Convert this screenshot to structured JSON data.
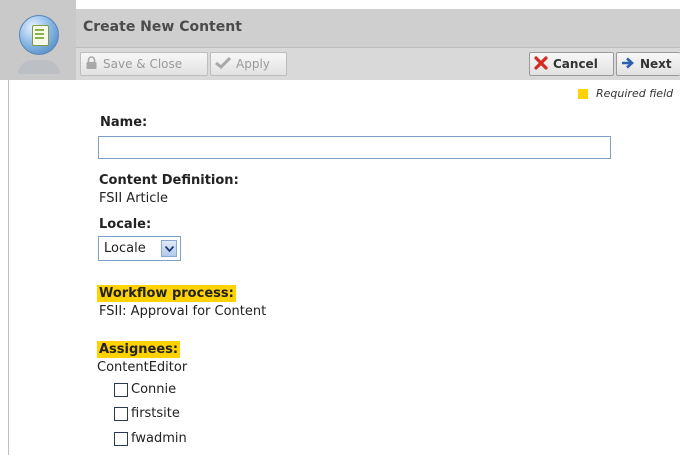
{
  "header": {
    "title": "Create New Content"
  },
  "toolbar": {
    "save_close": {
      "label": "Save & Close",
      "icon": "lock-icon"
    },
    "apply": {
      "label": "Apply",
      "icon": "checkmark-icon"
    },
    "cancel": {
      "label": "Cancel",
      "icon": "x-icon"
    },
    "next": {
      "label": "Next",
      "icon": "arrow-right-icon"
    }
  },
  "form": {
    "required_note": "Required field",
    "name_label": "Name:",
    "name_value": "",
    "content_definition_label": "Content Definition:",
    "content_definition_value": "FSII Article",
    "locale_label": "Locale:",
    "locale_selected": "Locale",
    "workflow_label": "Workflow process:",
    "workflow_value": "FSII: Approval for Content",
    "assignees_label": "Assignees:",
    "assignees_role": "ContentEditor",
    "assignees": [
      {
        "label": "Connie",
        "checked": false
      },
      {
        "label": "firstsite",
        "checked": false
      },
      {
        "label": "fwadmin",
        "checked": false
      }
    ]
  },
  "colors": {
    "required_highlight": "#ffd200",
    "title_bar": "#cfcfcf",
    "toolbar": "#d9d9d9"
  }
}
